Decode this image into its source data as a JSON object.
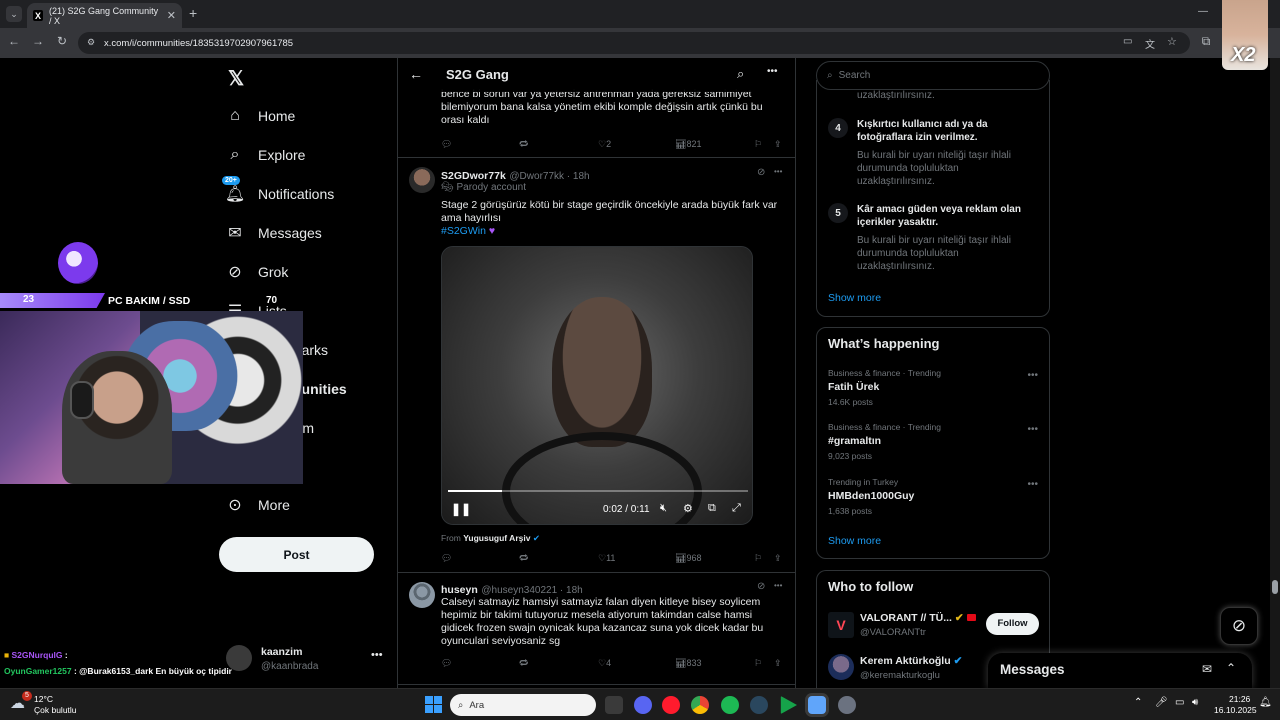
{
  "browser": {
    "tab_title": "(21) S2G Gang Community / X",
    "url": "x.com/i/communities/1835319702907961785",
    "new_tab": "+",
    "minimize": "—"
  },
  "nav": {
    "items": [
      {
        "label": "Home",
        "icon": "home-icon"
      },
      {
        "label": "Explore",
        "icon": "search-icon"
      },
      {
        "label": "Notifications",
        "icon": "bell-icon",
        "badge": "20+"
      },
      {
        "label": "Messages",
        "icon": "mail-icon"
      },
      {
        "label": "Grok",
        "icon": "grok-icon"
      },
      {
        "label": "Lists",
        "icon": "list-icon"
      },
      {
        "label": "Bookmarks",
        "icon": "bookmark-icon"
      },
      {
        "label": "Communities",
        "icon": "people-icon"
      },
      {
        "label": "Premium",
        "icon": "x-icon"
      },
      {
        "label": "More",
        "icon": "more-circle-icon"
      }
    ],
    "post_label": "Post",
    "account_name": "kaanzim",
    "account_handle": "@kaanbrada"
  },
  "stream_overlay": {
    "level": "23",
    "banner": "PC BAKIM / SSD",
    "count": "70",
    "chat": [
      {
        "user": "S2GNurqulG",
        "text": ":"
      },
      {
        "user": "OyunGamer1257",
        "text": ": @Burak6153_dark En büyük oç tipidir"
      }
    ],
    "brand": "X2"
  },
  "community": {
    "title": "S2G Gang",
    "tweets": [
      {
        "text": "bence bi sorun var ya yetersiz antrenman yada gereksiz samimiyet bilemiyorum bana kalsa yönetim ekibi komple değişsin artık çünkü bu orası kaldı",
        "likes": "2",
        "views": "821"
      },
      {
        "name": "S2GDwor77k",
        "handle": "@Dwor77kk · 18h",
        "label": "Parody account",
        "text": "Stage 2 görüşürüz kötü bir stage geçirdik öncekiyle arada büyük fark var ama hayırlısı",
        "hashtag": "#S2GWin",
        "video_time": "0:02 / 0:11",
        "video_progress": 0.18,
        "from_label": "From",
        "from_source": "Yugusuguf Arşiv",
        "likes": "11",
        "views": "968"
      },
      {
        "name": "huseyn",
        "handle": "@huseyn340221 · 18h",
        "text": "Calseyi satmayiz hamsiyi satmayiz falan diyen kitleye bisey soylicem hepimiz bir takimi tutuyoruz mesela atiyorum takimdan calse hamsi gidicek frozen swajn oynicak kupa kazancaz suna yok dicek kadar bu oyunculari seviyosaniz sg",
        "likes": "4",
        "views": "833"
      }
    ]
  },
  "right": {
    "search_placeholder": "Search",
    "rules_top_desc": "uzaklaştırılırsınız.",
    "rules": [
      {
        "num": "4",
        "title": "Kışkırtıcı kullanıcı adı ya da fotoğraflara izin verilmez.",
        "desc": "Bu kurali bir uyarı niteliği taşır ihlali durumunda topluluktan uzaklaştırılırsınız."
      },
      {
        "num": "5",
        "title": "Kâr amacı güden veya reklam olan içerikler yasaktır.",
        "desc": "Bu kurali bir uyarı niteliği taşır ihlali durumunda topluluktan uzaklaştırılırsınız."
      }
    ],
    "show_more": "Show more",
    "whats_happening": "What’s happening",
    "trends": [
      {
        "context": "Business & finance · Trending",
        "name": "Fatih Ürek",
        "posts": "14.6K posts"
      },
      {
        "context": "Business & finance · Trending",
        "name": "#gramaltın",
        "posts": "9,023 posts"
      },
      {
        "context": "Trending in Turkey",
        "name": "HMBden1000Guy",
        "posts": "1,638 posts"
      }
    ],
    "who_to_follow": "Who to follow",
    "follow": [
      {
        "name": "VALORANT // TÜ...",
        "handle": "@VALORANTtr",
        "button": "Follow"
      },
      {
        "name": "Kerem Aktürkoğlu",
        "handle": "@keremakturkoglu"
      }
    ],
    "messages_title": "Messages"
  },
  "taskbar": {
    "weather_temp": "12°C",
    "weather_desc": "Çok bulutlu",
    "search_placeholder": "Ara",
    "time": "21:26",
    "date": "16.10.2025",
    "notif_badge": "5"
  },
  "colors": {
    "accent": "#1d9bf0",
    "purple": "#8b5cf6",
    "bg": "#000000"
  }
}
